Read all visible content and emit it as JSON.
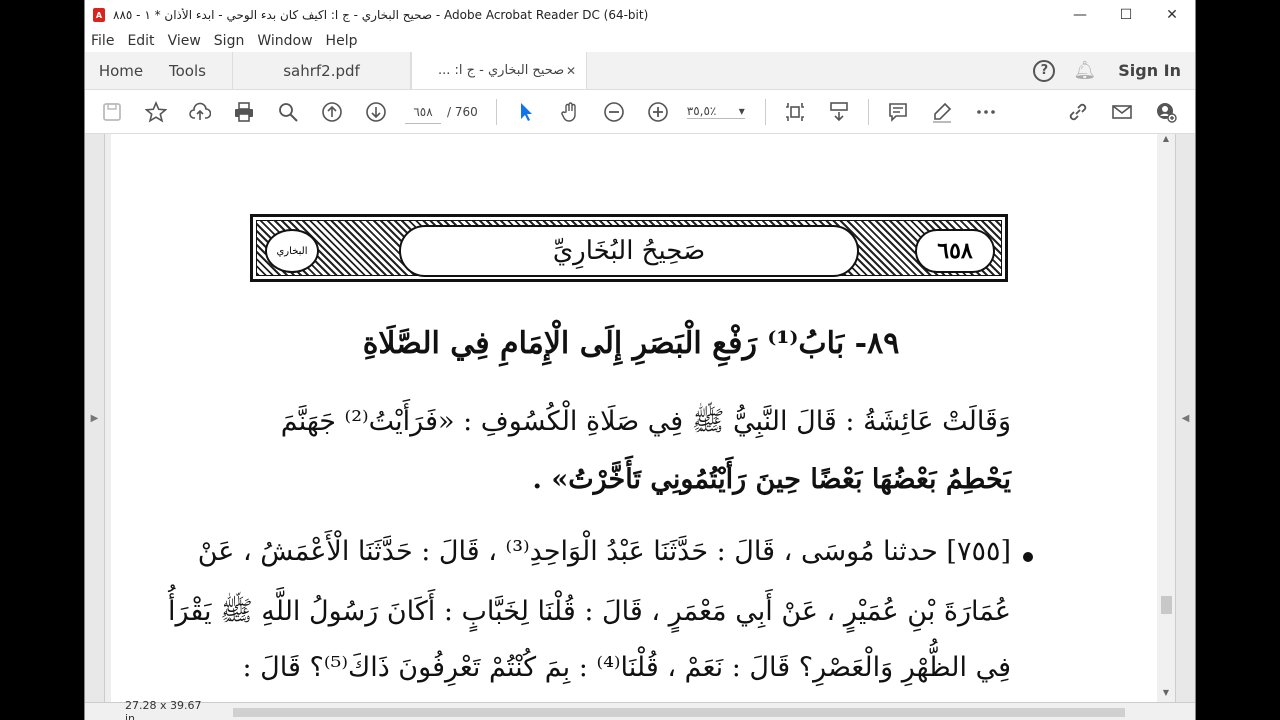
{
  "window": {
    "title": "صحيح البخاري - ج ا: اكيف كان بدء الوحي - ابدء الأذان * ١ - ٨٨٥ - Adobe Acrobat Reader DC (64-bit)",
    "app_icon_text": "A",
    "minimize": "—",
    "maximize": "☐",
    "close": "✕"
  },
  "menu": [
    "File",
    "Edit",
    "View",
    "Sign",
    "Window",
    "Help"
  ],
  "tabs": {
    "home": "Home",
    "tools": "Tools",
    "doc1": "sahrf2.pdf",
    "doc2": "صحيح البخاري - ج ا: ...",
    "doc2_close": "✕",
    "help": "?",
    "signin": "Sign In"
  },
  "toolbar": {
    "page_current": "٦٥٨",
    "page_total": "/ 760",
    "zoom": "٣٥,٥٪",
    "zoom_caret": "▾"
  },
  "page": {
    "header_title": "صَحِيحُ البُخَارِيِّ",
    "page_number": "٦٥٨",
    "seal_text": "البخاري",
    "chapter": "٨٩- بَابُ⁽¹⁾ رَفْعِ الْبَصَرِ إِلَى الْإِمَامِ فِي الصَّلَاةِ",
    "line1": "وَقَالَتْ عَائِشَةُ : قَالَ النَّبِيُّ ﷺ فِي صَلَاةِ الْكُسُوفِ : «فَرَأَيْتُ⁽²⁾ جَهَنَّمَ",
    "line2": "يَحْطِمُ بَعْضُهَا بَعْضًا حِينَ رَأَيْتُمُونِي تَأَخَّرْتُ» .",
    "line3": "[٧٥٥] حدثنا مُوسَى ، قَالَ : حَدَّثَنَا عَبْدُ الْوَاحِدِ⁽³⁾ ، قَالَ : حَدَّثَنَا الْأَعْمَشُ ، عَنْ",
    "line4": "عُمَارَةَ بْنِ عُمَيْرٍ ، عَنْ أَبِي مَعْمَرٍ ، قَالَ : قُلْنَا لِخَبَّابٍ : أَكَانَ رَسُولُ اللَّهِ ﷺ يَقْرَأُ",
    "line5": "فِي الظُّهْرِ وَالْعَصْرِ؟ قَالَ : نَعَمْ ، قُلْنَا⁽⁴⁾ : بِمَ كُنْتُمْ تَعْرِفُونَ ذَاكَ⁽⁵⁾؟ قَالَ :"
  },
  "status": {
    "dimensions": "27.28 x 39.67 in"
  },
  "icons": [
    "save-icon",
    "bookmark-star-icon",
    "upload-icon",
    "print-icon",
    "zoom-search-icon",
    "page-up-icon",
    "page-down-icon",
    "select-arrow-icon",
    "hand-icon",
    "zoom-out-icon",
    "zoom-in-icon",
    "fit-page-icon",
    "scroll-mode-icon",
    "comment-icon",
    "highlight-pen-icon",
    "more-icon",
    "link-icon",
    "email-icon",
    "add-user-icon"
  ],
  "colors": {
    "accent": "#d9231b",
    "select_tool": "#1473e6"
  }
}
